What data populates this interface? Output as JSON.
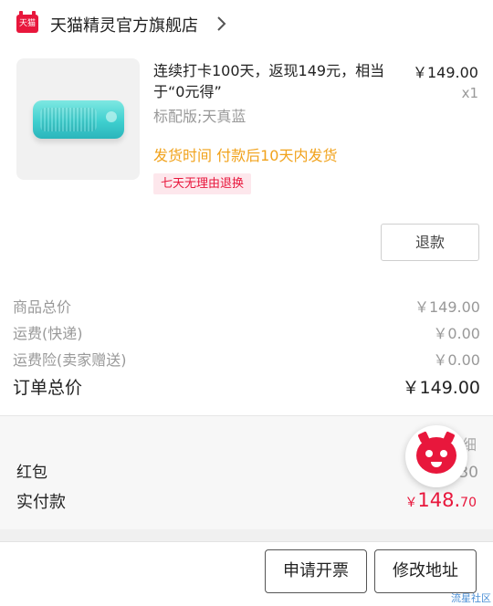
{
  "store": {
    "logo_text": "天猫",
    "name": "天猫精灵官方旗舰店"
  },
  "product": {
    "title": "连续打卡100天，返现149元，相当于“0元得”",
    "price": "￥149.00",
    "quantity": "x1",
    "sku": "标配版;天真蓝",
    "shipping": "发货时间  付款后10天内发货",
    "return_policy": "七天无理由退换",
    "image_color": "#3fcfcf"
  },
  "actions": {
    "refund": "退款",
    "invoice": "申请开票",
    "modify_address": "修改地址"
  },
  "summary": {
    "rows": [
      {
        "label": "商品总价",
        "value": "￥149.00"
      },
      {
        "label": "运费(快递)",
        "value": "￥0.00"
      },
      {
        "label": "运费险(卖家赠送)",
        "value": "￥0.00"
      }
    ],
    "total_label": "订单总价",
    "total_value": "￥149.00"
  },
  "payment": {
    "partial_label": "天   明细",
    "red_packet_label": "红包",
    "red_packet_value": "￥0.30",
    "paid_label": "实付款",
    "paid_currency": "￥",
    "paid_integer": "148.",
    "paid_decimal": "70"
  },
  "watermark": "流星社区",
  "colors": {
    "accent": "#e8173c",
    "shipping": "#f1a21b",
    "muted": "#999999"
  }
}
